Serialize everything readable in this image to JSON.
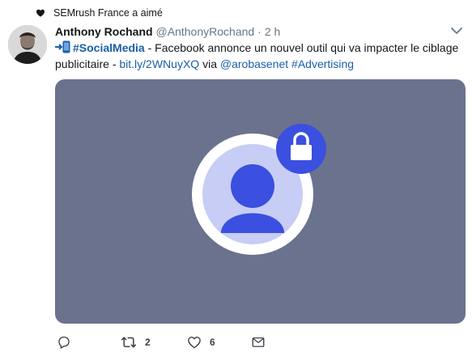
{
  "social_context": {
    "text": "SEMrush France a aimé",
    "icon": "heart-icon"
  },
  "tweet": {
    "author_name": "Anthony Rochand",
    "author_handle": "@AnthonyRochand",
    "separator": "·",
    "time": "2 h",
    "hashtag_social": "#SocialMedia",
    "text_part1": " - Facebook annonce un nouvel outil qui va impacter le ciblage publicitaire - ",
    "link": "bit.ly/2WNuyXQ",
    "text_via": " via ",
    "mention": "@arobasenet",
    "hashtag_advertising": "#Advertising"
  },
  "media": {
    "background_color": "#6b728e",
    "icon": "locked-profile-icon",
    "accent_color": "#3b4fe0"
  },
  "actions": {
    "reply_count": "",
    "retweet_count": "2",
    "like_count": "6"
  },
  "colors": {
    "link": "#1b5fa8",
    "muted": "#657786",
    "text": "#14171a"
  }
}
